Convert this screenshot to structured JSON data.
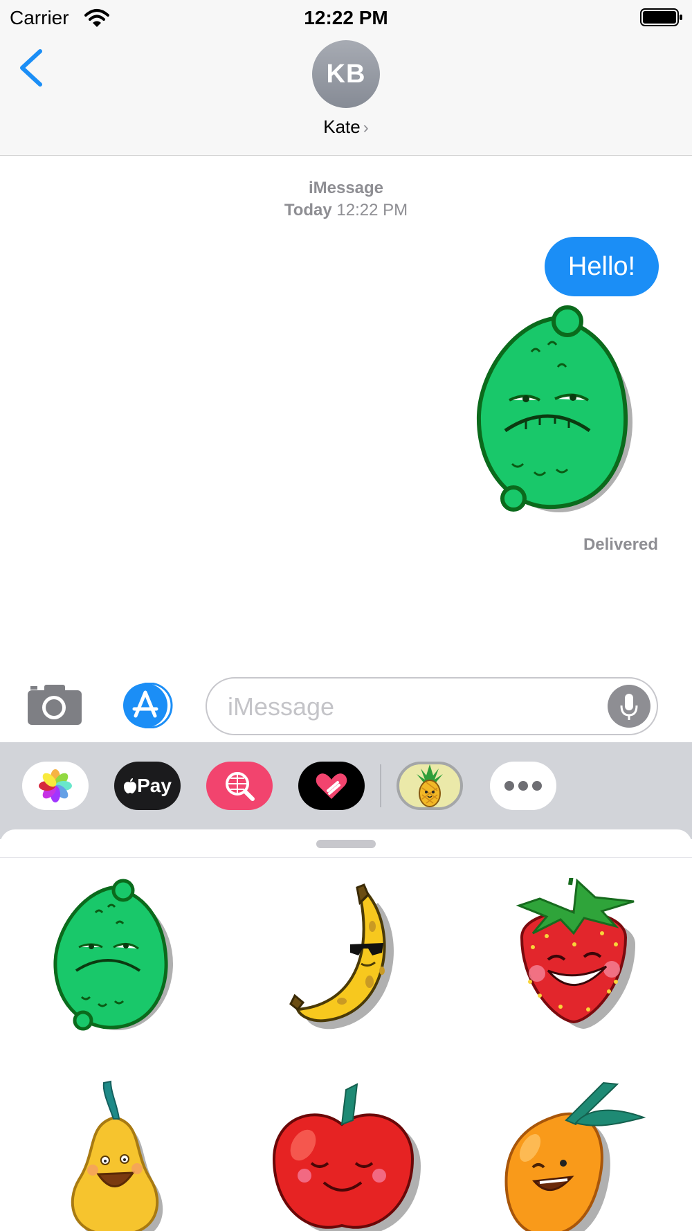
{
  "status_bar": {
    "carrier": "Carrier",
    "time": "12:22 PM"
  },
  "nav": {
    "avatar_initials": "KB",
    "contact_name": "Kate",
    "chevron": "›"
  },
  "conversation": {
    "service": "iMessage",
    "timestamp_day": "Today",
    "timestamp_time": "12:22 PM",
    "sent_message": "Hello!",
    "delivery_status": "Delivered"
  },
  "input": {
    "placeholder": "iMessage"
  },
  "drawer": {
    "apps": [
      "photos-icon",
      "apple-pay",
      "search-images",
      "digital-touch",
      "fruit-stickers",
      "more"
    ],
    "apple_pay_label": " Pay",
    "colors": {
      "accent": "#1b8ef6",
      "applepay_bg": "#1b1b1d",
      "search_bg": "#f2446e",
      "selected_app_bg": "#ebe9a9"
    }
  },
  "stickers": [
    "lime",
    "banana",
    "strawberry",
    "pear",
    "apple",
    "mango"
  ]
}
